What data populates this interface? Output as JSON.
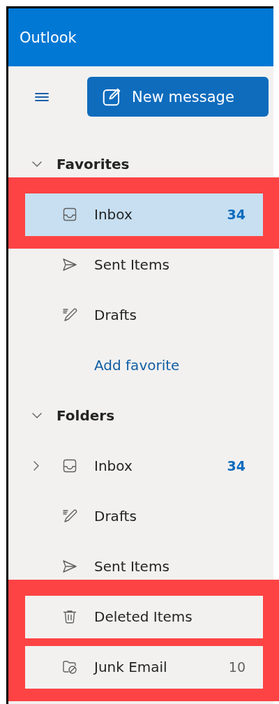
{
  "app": {
    "title": "Outlook"
  },
  "toolbar": {
    "new_message_button": {
      "label": "New message"
    }
  },
  "sections": [
    {
      "title": "Favorites",
      "expanded": true,
      "items": [
        {
          "kind": "inbox",
          "label": "Inbox",
          "count": "34",
          "count_bold": true,
          "selected": true,
          "highlighted": true
        },
        {
          "kind": "sent",
          "label": "Sent Items",
          "selected": false,
          "highlighted": false
        },
        {
          "kind": "drafts",
          "label": "Drafts",
          "selected": false,
          "highlighted": false
        },
        {
          "kind": "link",
          "label": "Add favorite",
          "selected": false,
          "highlighted": false
        }
      ]
    },
    {
      "title": "Folders",
      "expanded": true,
      "items": [
        {
          "kind": "inbox",
          "label": "Inbox",
          "count": "34",
          "count_bold": true,
          "expanded": false,
          "selected": false,
          "highlighted": false
        },
        {
          "kind": "drafts",
          "label": "Drafts",
          "selected": false,
          "highlighted": false
        },
        {
          "kind": "sent",
          "label": "Sent Items",
          "selected": false,
          "highlighted": false
        },
        {
          "kind": "deleted",
          "label": "Deleted Items",
          "selected": false,
          "highlighted": true
        },
        {
          "kind": "junk",
          "label": "Junk Email",
          "count": "10",
          "count_bold": false,
          "selected": false,
          "highlighted": true
        }
      ]
    }
  ]
}
